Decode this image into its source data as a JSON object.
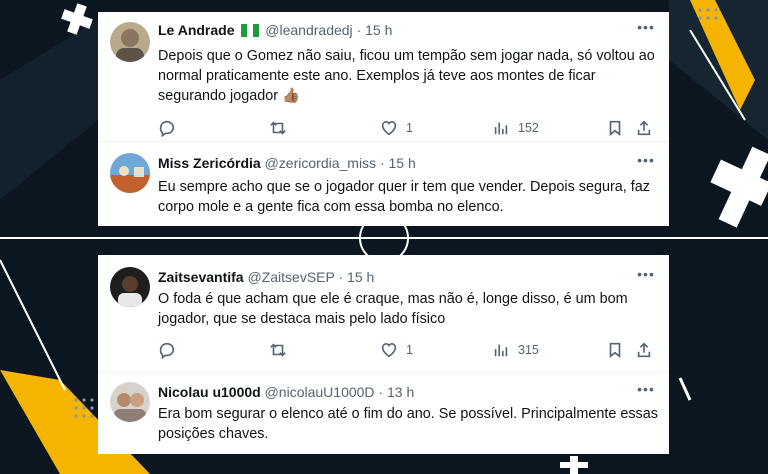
{
  "tweets_top": [
    {
      "name": "Le Andrade",
      "handle": "@leandradedj",
      "time": "· 15 h",
      "text": "Depois que o Gomez não saiu, ficou um tempão sem jogar nada, só voltou ao normal praticamente este ano. Exemplos já teve aos montes de ficar segurando jogador 👍🏽",
      "likes": "1",
      "views": "152"
    },
    {
      "name": "Miss Zericórdia",
      "handle": "@zericordia_miss",
      "time": "· 15 h",
      "text": "Eu sempre acho que se o jogador quer ir tem que vender. Depois segura, faz corpo mole e a gente fica com essa bomba no elenco."
    }
  ],
  "tweets_bottom": [
    {
      "name": "Zaitsevantifa",
      "handle": "@ZaitsevSEP",
      "time": "· 15 h",
      "text": "O foda é que acham que ele é craque, mas não é, longe disso, é um bom jogador, que se destaca mais pelo lado físico",
      "likes": "1",
      "views": "315"
    },
    {
      "name": "Nicolau u1000d",
      "handle": "@nicolauU1000D",
      "time": "· 13 h",
      "text": "Era bom segurar o elenco até o fim do ano. Se possível. Principalmente essas posições chaves."
    }
  ],
  "more_glyph": "•••",
  "colors": {
    "accent": "#f5b400",
    "text": "#0f1419",
    "muted": "#536471",
    "background": "#0b1620"
  }
}
